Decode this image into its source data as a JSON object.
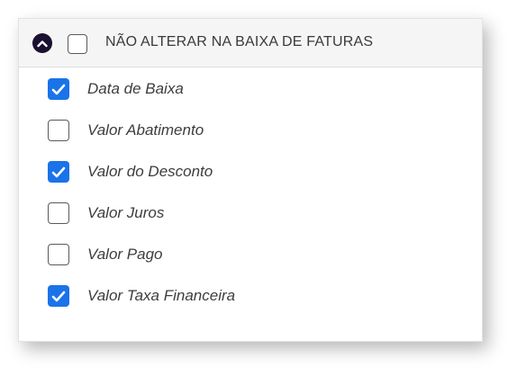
{
  "header": {
    "label": "NÃO ALTERAR NA BAIXA DE FATURAS",
    "checked": false,
    "collapse_icon": "chevron-up-circle-icon"
  },
  "items": [
    {
      "label": "Data de Baixa",
      "checked": true
    },
    {
      "label": "Valor Abatimento",
      "checked": false
    },
    {
      "label": "Valor do Desconto",
      "checked": true
    },
    {
      "label": "Valor Juros",
      "checked": false
    },
    {
      "label": "Valor Pago",
      "checked": false
    },
    {
      "label": "Valor Taxa Financeira",
      "checked": true
    }
  ],
  "colors": {
    "checked_fill": "#1a73e8",
    "header_bg": "#f5f5f5",
    "icon_fill": "#1a1030"
  }
}
